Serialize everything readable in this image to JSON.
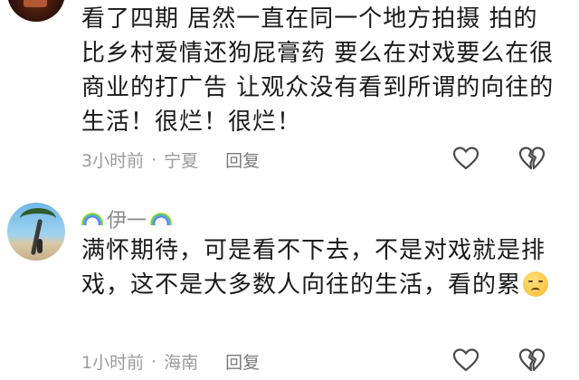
{
  "comments": [
    {
      "text": "看了四期 居然一直在同一个地方拍摄 拍的比乡村爱情还狗屁膏药 要么在对戏要么在很商业的打广告 让观众没有看到所谓的向往的生活！很烂！很烂！",
      "time": "3小时前",
      "location": "宁夏",
      "reply_label": "回复"
    },
    {
      "username": "伊一",
      "text": "满怀期待，可是看不下去，不是对戏就是排戏，这不是大多数人向往的生活，看的累",
      "emoji": "disappointed-face",
      "time": "1小时前",
      "location": "海南",
      "reply_label": "回复"
    }
  ],
  "separator": "·",
  "icons": {
    "like": "heart-icon",
    "dislike": "broken-heart-icon"
  },
  "colors": {
    "text": "#1a1a1a",
    "meta": "#9a9a9a",
    "icon": "#4a4a4a"
  }
}
